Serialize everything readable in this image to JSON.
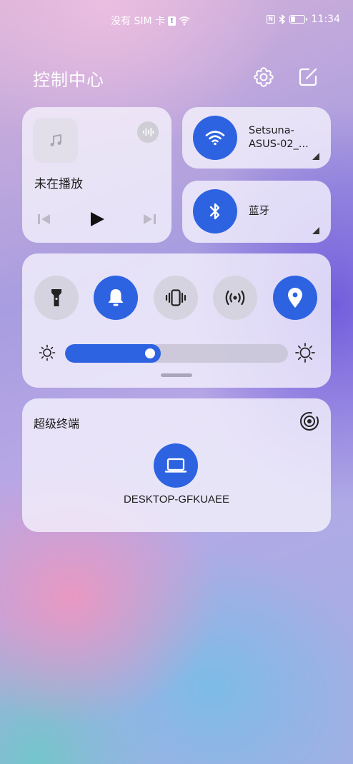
{
  "status_bar": {
    "carrier": "没有 SIM 卡",
    "sim_badge": "!",
    "nfc": "N",
    "battery_level": 0.35,
    "time": "11:34"
  },
  "header": {
    "title": "控制中心",
    "icons": [
      "settings-icon",
      "edit-icon"
    ]
  },
  "media": {
    "status": "未在播放",
    "icons": [
      "music-note-icon",
      "sound-wave-icon",
      "previous-icon",
      "play-icon",
      "next-icon"
    ]
  },
  "wifi": {
    "network_line1": "Setsuna-",
    "network_line2": "ASUS-02_..."
  },
  "bluetooth": {
    "label": "蓝牙"
  },
  "toggles": [
    {
      "name": "flashlight",
      "active": false
    },
    {
      "name": "sound",
      "active": true
    },
    {
      "name": "vibrate",
      "active": false
    },
    {
      "name": "hotspot",
      "active": false
    },
    {
      "name": "location",
      "active": true
    }
  ],
  "brightness": {
    "level": 0.43
  },
  "super_device": {
    "title": "超级终端",
    "device_name": "DESKTOP-GFKUAEE"
  },
  "colors": {
    "accent": "#2d63e1"
  }
}
